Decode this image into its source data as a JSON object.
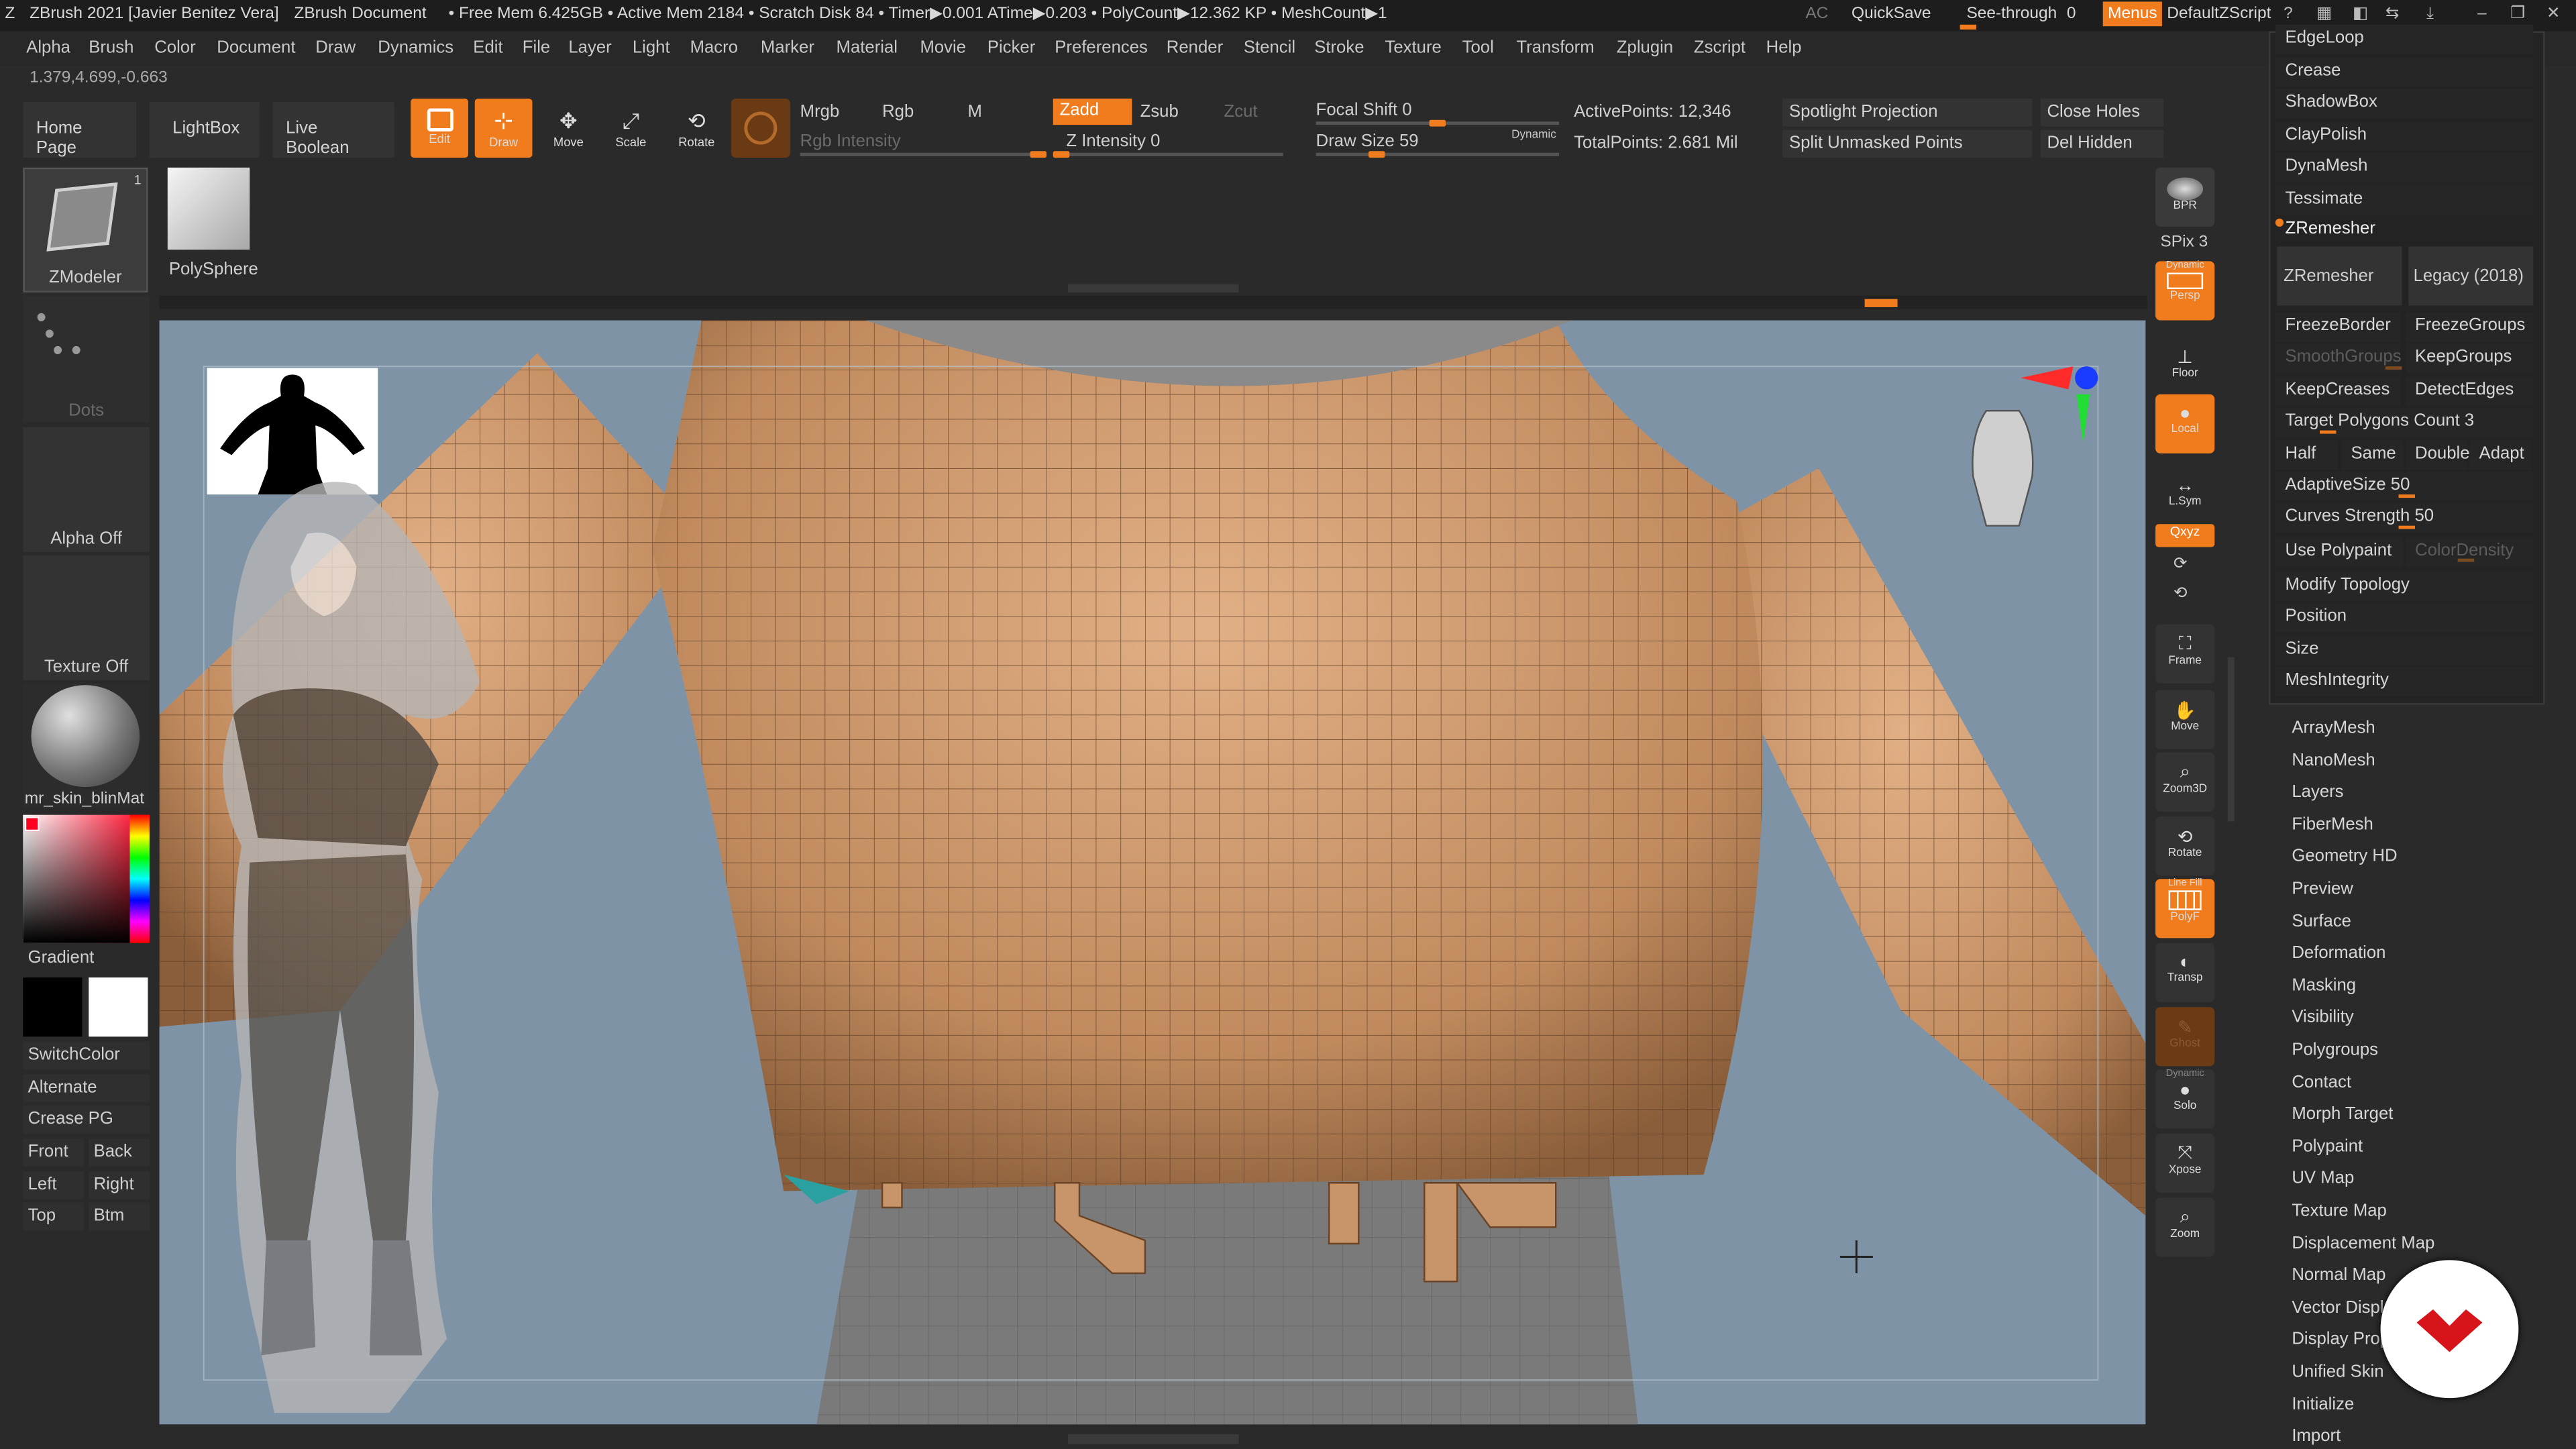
{
  "titlebar": {
    "app_title": "ZBrush 2021 [Javier Benitez Vera]",
    "document": "ZBrush Document",
    "stats": "• Free Mem 6.425GB • Active Mem 2184 • Scratch Disk 84 • Timer▶0.001 ATime▶0.203 • PolyCount▶12.362 KP • MeshCount▶1",
    "ac": "AC",
    "quicksave": "QuickSave",
    "see_through": "See-through",
    "see_through_val": "0",
    "menus": "Menus",
    "default_zscript": "DefaultZScript"
  },
  "menu": [
    "Alpha",
    "Brush",
    "Color",
    "Document",
    "Draw",
    "Dynamics",
    "Edit",
    "File",
    "Layer",
    "Light",
    "Macro",
    "Marker",
    "Material",
    "Movie",
    "Picker",
    "Preferences",
    "Render",
    "Stencil",
    "Stroke",
    "Texture",
    "Tool",
    "Transform",
    "Zplugin",
    "Zscript",
    "Help"
  ],
  "coords": "1.379,4.699,-0.663",
  "shelf": {
    "home_page": "Home Page",
    "lightbox": "LightBox",
    "live_boolean": "Live Boolean",
    "edit": "Edit",
    "draw": "Draw",
    "move": "Move",
    "scale": "Scale",
    "rotate": "Rotate",
    "mrgb": "Mrgb",
    "rgb": "Rgb",
    "m": "M",
    "rgb_intensity": "Rgb Intensity",
    "zadd": "Zadd",
    "zsub": "Zsub",
    "zcut": "Zcut",
    "z_intensity": "Z Intensity 0",
    "focal_shift": "Focal Shift 0",
    "draw_size": "Draw Size 59",
    "dynamic": "Dynamic",
    "active_points": "ActivePoints: 12,346",
    "total_points": "TotalPoints: 2.681 Mil",
    "spotlight": "Spotlight Projection",
    "split_unmasked": "Split Unmasked Points",
    "close_holes": "Close Holes",
    "del_hidden": "Del Hidden"
  },
  "tool_thumbs": {
    "zmodeler": "ZModeler",
    "zmodeler_count": "1",
    "polysphere": "PolySphere"
  },
  "left": {
    "dots": "Dots",
    "alpha_off": "Alpha Off",
    "texture_off": "Texture Off",
    "material": "mr_skin_blinMat",
    "gradient": "Gradient",
    "switchcolor": "SwitchColor",
    "alternate": "Alternate",
    "crease_pg": "Crease PG",
    "front": "Front",
    "back": "Back",
    "left": "Left",
    "right": "Right",
    "top": "Top",
    "btm": "Btm"
  },
  "right_shelf": {
    "bpr": "BPR",
    "spix": "SPix 3",
    "persp": "Persp",
    "dynamic": "Dynamic",
    "floor": "Floor",
    "local": "Local",
    "lsym": "L.Sym",
    "xyz": "Qxyz",
    "frame": "Frame",
    "move": "Move",
    "zoom3d": "Zoom3D",
    "rotate": "Rotate",
    "line_fill": "Line Fill",
    "polyf": "PolyF",
    "transp": "Transp",
    "ghost": "Ghost",
    "solo": "Solo",
    "xpose": "Xpose",
    "zoom": "Zoom"
  },
  "right_panel": {
    "top_items": [
      "EdgeLoop",
      "Crease",
      "ShadowBox",
      "ClayPolish",
      "DynaMesh",
      "Tessimate"
    ],
    "zremesher_header": "ZRemesher",
    "zremesher_btn": "ZRemesher",
    "legacy": "Legacy (2018)",
    "freezeborder": "FreezeBorder",
    "freezegroups": "FreezeGroups",
    "smoothgroups": "SmoothGroups",
    "keepgroups": "KeepGroups",
    "keepcreases": "KeepCreases",
    "detectedges": "DetectEdges",
    "target_polys": "Target Polygons Count 3",
    "half": "Half",
    "same": "Same",
    "double": "Double",
    "adapt": "Adapt",
    "adaptive_size": "AdaptiveSize 50",
    "curves_strength": "Curves Strength 50",
    "use_polypaint": "Use Polypaint",
    "color_density": "ColorDensity",
    "modify_topology": "Modify Topology",
    "position": "Position",
    "size": "Size",
    "meshintegrity": "MeshIntegrity",
    "sub_items": [
      "ArrayMesh",
      "NanoMesh",
      "Layers",
      "FiberMesh",
      "Geometry HD",
      "Preview",
      "Surface",
      "Deformation",
      "Masking",
      "Visibility",
      "Polygroups",
      "Contact",
      "Morph Target",
      "Polypaint",
      "UV Map",
      "Texture Map",
      "Displacement Map",
      "Normal Map",
      "Vector Displ",
      "Display Prop",
      "Unified Skin",
      "Initialize",
      "Import"
    ]
  },
  "colors": {
    "accent": "#f07c1e",
    "canvas": "#7e93a6",
    "mesh": "#c8956a"
  }
}
